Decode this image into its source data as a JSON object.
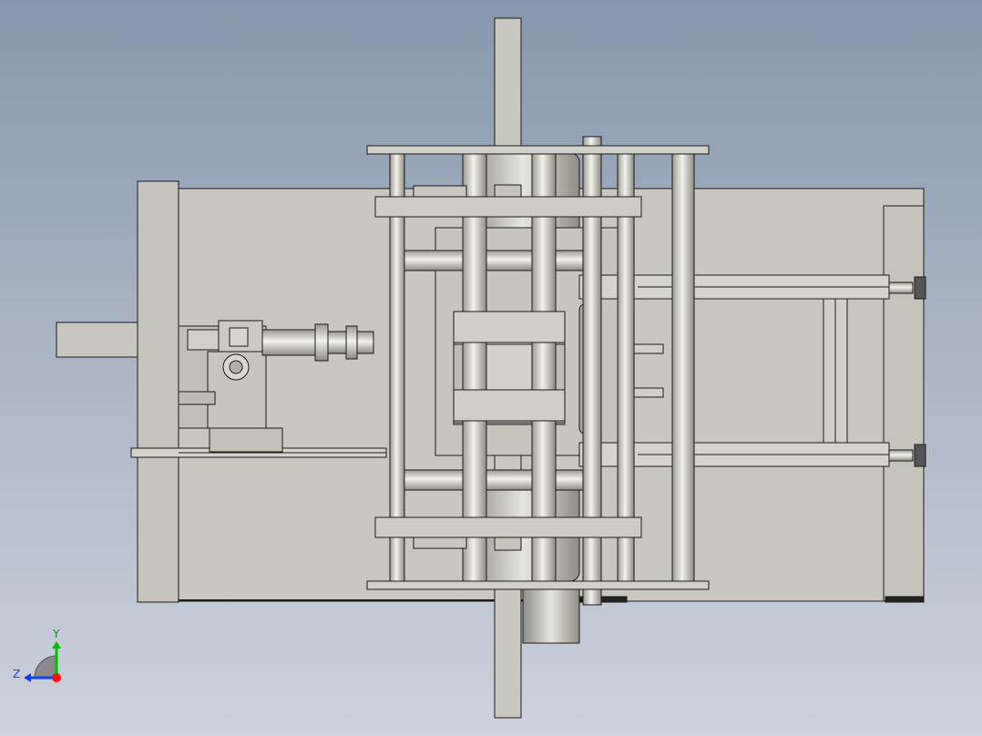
{
  "viewport": {
    "background_top": "#8797ad",
    "background_bottom": "#cdd2dc"
  },
  "model": {
    "part_fill": "#c8c8c0",
    "part_fill_dark": "#b8b8ae",
    "edge_color": "#1a1a1a"
  },
  "triad": {
    "y_label": "Y",
    "z_label": "Z",
    "y_color": "#00c000",
    "z_color": "#1040ff",
    "x_color": "#ff1010"
  }
}
